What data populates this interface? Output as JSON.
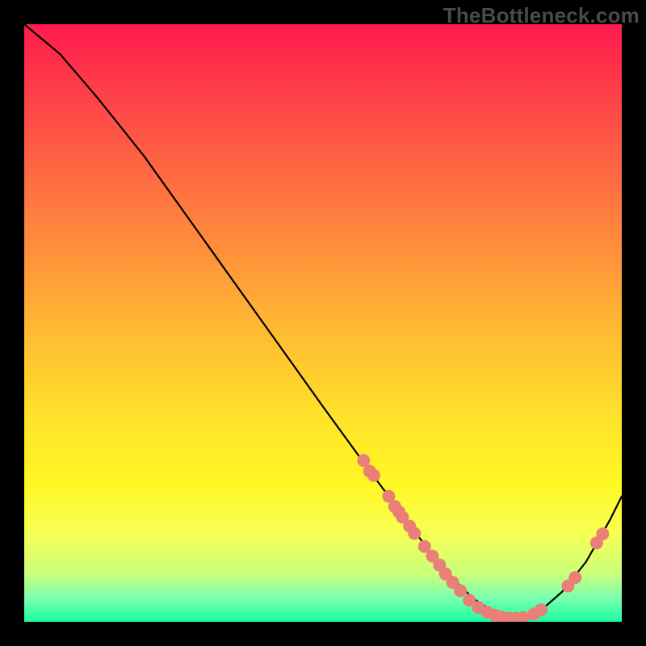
{
  "watermark": "TheBottleneck.com",
  "colors": {
    "dot": "#e97f77",
    "curve": "#000000",
    "frame_bg_top": "#ff1a4d",
    "frame_bg_bottom": "#1aff9e",
    "page_bg": "#000000"
  },
  "chart_data": {
    "type": "line",
    "title": "",
    "xlabel": "",
    "ylabel": "",
    "xlim": [
      0,
      100
    ],
    "ylim": [
      0,
      100
    ],
    "grid": false,
    "legend": false,
    "series": [
      {
        "name": "bottleneck-curve",
        "x": [
          0,
          6,
          12,
          20,
          30,
          40,
          50,
          58,
          64,
          68,
          72,
          75,
          78,
          80,
          83,
          86,
          90,
          94,
          98,
          100
        ],
        "y": [
          100,
          95,
          88,
          78,
          64,
          50,
          36,
          25,
          17,
          11.5,
          7,
          4,
          2,
          1,
          0.5,
          1.5,
          5,
          10,
          17,
          21
        ]
      }
    ],
    "scatter_points": [
      {
        "x": 56.8,
        "y": 27.0
      },
      {
        "x": 57.8,
        "y": 25.2
      },
      {
        "x": 58.5,
        "y": 24.5
      },
      {
        "x": 61.0,
        "y": 21.0
      },
      {
        "x": 62.0,
        "y": 19.3
      },
      {
        "x": 62.7,
        "y": 18.4
      },
      {
        "x": 63.3,
        "y": 17.5
      },
      {
        "x": 64.5,
        "y": 16.0
      },
      {
        "x": 65.3,
        "y": 14.8
      },
      {
        "x": 67.0,
        "y": 12.6
      },
      {
        "x": 68.3,
        "y": 11.0
      },
      {
        "x": 69.5,
        "y": 9.5
      },
      {
        "x": 70.5,
        "y": 8.0
      },
      {
        "x": 71.7,
        "y": 6.6
      },
      {
        "x": 73.0,
        "y": 5.2
      },
      {
        "x": 74.5,
        "y": 3.6
      },
      {
        "x": 76.0,
        "y": 2.4
      },
      {
        "x": 77.5,
        "y": 1.6
      },
      {
        "x": 78.7,
        "y": 1.1
      },
      {
        "x": 79.8,
        "y": 0.8
      },
      {
        "x": 81.0,
        "y": 0.6
      },
      {
        "x": 82.3,
        "y": 0.6
      },
      {
        "x": 83.5,
        "y": 0.7
      },
      {
        "x": 85.3,
        "y": 1.3
      },
      {
        "x": 86.5,
        "y": 2.0
      },
      {
        "x": 91.0,
        "y": 6.0
      },
      {
        "x": 92.2,
        "y": 7.4
      },
      {
        "x": 95.8,
        "y": 13.2
      },
      {
        "x": 96.8,
        "y": 14.7
      }
    ]
  }
}
